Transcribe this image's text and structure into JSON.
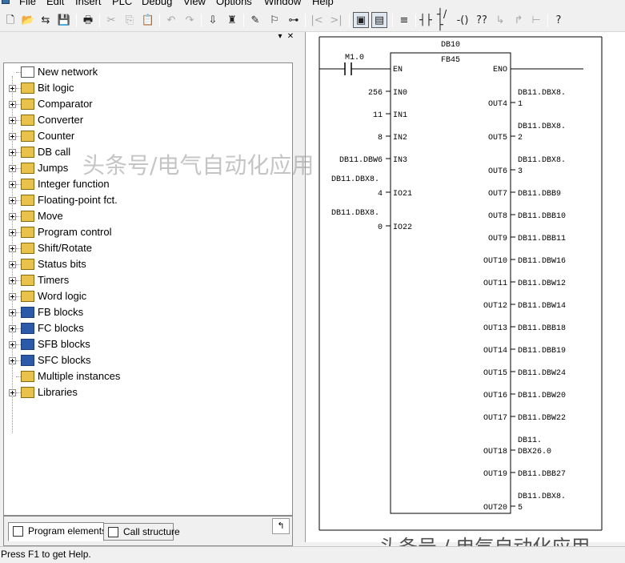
{
  "menubar": {
    "items": [
      "File",
      "Edit",
      "Insert",
      "PLC",
      "Debug",
      "View",
      "Options",
      "Window",
      "Help"
    ]
  },
  "toolbar": {
    "icons": [
      "new-icon",
      "open-icon",
      "accessible-nodes-icon",
      "save-icon",
      "print-icon",
      "cut-icon",
      "copy-icon",
      "paste-icon",
      "undo-icon",
      "redo-icon",
      "download-icon",
      "monitor-icon",
      "comment-icon",
      "overview-icon",
      "display-icon",
      "goto-begin-icon",
      "goto-end-icon",
      "overview-toggle-icon",
      "network-view-icon",
      "new-network-icon",
      "no-contact-icon",
      "nc-contact-icon",
      "coil-icon",
      "empty-box-icon",
      "branch-open-icon",
      "branch-close-icon",
      "connection-icon",
      "help-icon"
    ]
  },
  "panel": {
    "tree": [
      {
        "label": "New network",
        "icon": "new-network-icon",
        "expandable": false
      },
      {
        "label": "Bit logic",
        "icon": "bit-logic-icon",
        "expandable": true
      },
      {
        "label": "Comparator",
        "icon": "comparator-icon",
        "expandable": true
      },
      {
        "label": "Converter",
        "icon": "converter-icon",
        "expandable": true
      },
      {
        "label": "Counter",
        "icon": "counter-icon",
        "expandable": true
      },
      {
        "label": "DB call",
        "icon": "db-call-icon",
        "expandable": true
      },
      {
        "label": "Jumps",
        "icon": "jumps-icon",
        "expandable": true
      },
      {
        "label": "Integer function",
        "icon": "integer-function-icon",
        "expandable": true
      },
      {
        "label": "Floating-point fct.",
        "icon": "floating-point-icon",
        "expandable": true
      },
      {
        "label": "Move",
        "icon": "move-icon",
        "expandable": true
      },
      {
        "label": "Program control",
        "icon": "program-control-icon",
        "expandable": true
      },
      {
        "label": "Shift/Rotate",
        "icon": "shift-rotate-icon",
        "expandable": true
      },
      {
        "label": "Status bits",
        "icon": "status-bits-icon",
        "expandable": true
      },
      {
        "label": "Timers",
        "icon": "timers-icon",
        "expandable": true
      },
      {
        "label": "Word logic",
        "icon": "word-logic-icon",
        "expandable": true
      },
      {
        "label": "FB blocks",
        "icon": "fb-blocks-icon",
        "expandable": true
      },
      {
        "label": "FC blocks",
        "icon": "fc-blocks-icon",
        "expandable": true
      },
      {
        "label": "SFB blocks",
        "icon": "sfb-blocks-icon",
        "expandable": true
      },
      {
        "label": "SFC blocks",
        "icon": "sfc-blocks-icon",
        "expandable": true
      },
      {
        "label": "Multiple instances",
        "icon": "multiple-instances-icon",
        "expandable": false
      },
      {
        "label": "Libraries",
        "icon": "libraries-icon",
        "expandable": true
      }
    ],
    "tabs": [
      "Program elements",
      "Call structure"
    ]
  },
  "ladder": {
    "db": "DB10",
    "fb": "FB45",
    "contact": "M1.0",
    "en": "EN",
    "eno": "ENO",
    "inputs": [
      {
        "pin": "IN0",
        "value": "256"
      },
      {
        "pin": "IN1",
        "value": "11"
      },
      {
        "pin": "IN2",
        "value": "8"
      },
      {
        "pin": "IN3",
        "value": "DB11.DBW6"
      },
      {
        "pin": "IO21",
        "value": "DB11.DBX8.",
        "value2": "4"
      },
      {
        "pin": "IO22",
        "value": "DB11.DBX8.",
        "value2": "0"
      }
    ],
    "outputs": [
      {
        "pin": "OUT4",
        "value": "DB11.DBX8.",
        "value2": "1"
      },
      {
        "pin": "OUT5",
        "value": "DB11.DBX8.",
        "value2": "2"
      },
      {
        "pin": "OUT6",
        "value": "DB11.DBX8.",
        "value2": "3"
      },
      {
        "pin": "OUT7",
        "value": "DB11.DBB9"
      },
      {
        "pin": "OUT8",
        "value": "DB11.DBB10"
      },
      {
        "pin": "OUT9",
        "value": "DB11.DBB11"
      },
      {
        "pin": "OUT10",
        "value": "DB11.DBW16"
      },
      {
        "pin": "OUT11",
        "value": "DB11.DBW12"
      },
      {
        "pin": "OUT12",
        "value": "DB11.DBW14"
      },
      {
        "pin": "OUT13",
        "value": "DB11.DBB18"
      },
      {
        "pin": "OUT14",
        "value": "DB11.DBB19"
      },
      {
        "pin": "OUT15",
        "value": "DB11.DBW24"
      },
      {
        "pin": "OUT16",
        "value": "DB11.DBW20"
      },
      {
        "pin": "OUT17",
        "value": "DB11.DBW22"
      },
      {
        "pin": "OUT18",
        "value": "DB11.",
        "value2": "DBX26.0"
      },
      {
        "pin": "OUT19",
        "value": "DB11.DBB27"
      },
      {
        "pin": "OUT20",
        "value": "DB11.DBX8.",
        "value2": "5"
      }
    ]
  },
  "status": {
    "text": "Press F1 to get Help."
  },
  "watermark": {
    "text": "头条号/电气自动化应用",
    "text2": "头条号 / 电气自动化应用"
  }
}
